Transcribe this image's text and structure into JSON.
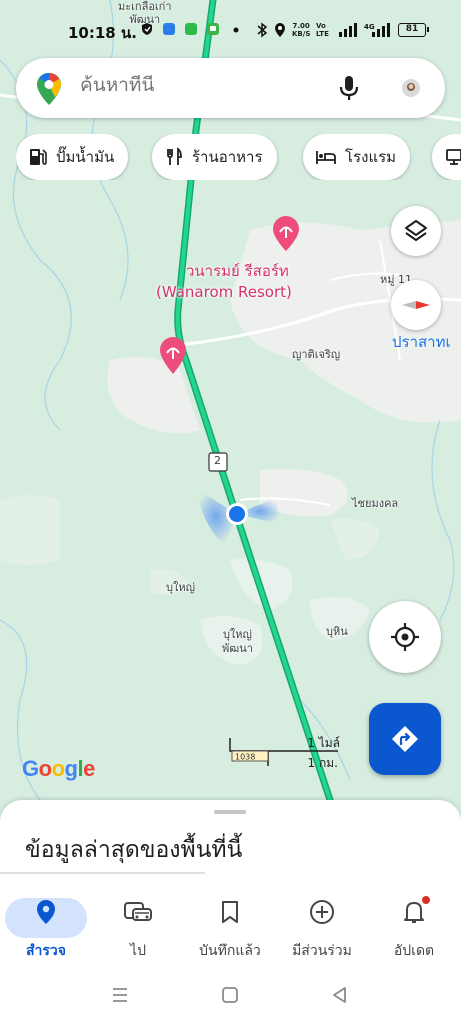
{
  "status_bar": {
    "time": "10:18 น.",
    "net_speed": "7.00\nKB/S",
    "volte": "Vo\nLTE",
    "battery": "81"
  },
  "search": {
    "placeholder": "ค้นหาที่นี่"
  },
  "chips": [
    {
      "label": "ปั๊มน้ำมัน",
      "icon": "gas-station-icon"
    },
    {
      "label": "ร้านอาหาร",
      "icon": "restaurant-icon"
    },
    {
      "label": "โรงแรม",
      "icon": "hotel-icon"
    }
  ],
  "map": {
    "labels": {
      "top_town": "มะเกลือเก่า\nพัฒนา",
      "resort_thai": "วนารมย์ รีสอร์ท",
      "resort_en": "(Wanarom Resort)",
      "moo11": "หมู่ 11",
      "prasat": "ปราสาทเ",
      "yatijaroen": "ญาติเจริญ",
      "road_shield": "2",
      "chaimongkol": "ไชยมงคล",
      "buyai": "บุใหญ่",
      "buyai_pattana": "บุใหญ่\nพัฒนา",
      "buhin": "บุหิน",
      "route_shield": "1038"
    },
    "scale": {
      "miles": "1 ไมล์",
      "km": "1 กม."
    },
    "google": "Google"
  },
  "bottom_sheet": {
    "title": "ข้อมูลล่าสุดของพื้นที่นี้"
  },
  "nav": {
    "items": [
      {
        "label": "สำรวจ",
        "icon": "explore-pin-icon",
        "active": true
      },
      {
        "label": "ไป",
        "icon": "go-car-icon",
        "active": false
      },
      {
        "label": "บันทึกแล้ว",
        "icon": "bookmark-icon",
        "active": false
      },
      {
        "label": "มีส่วนร่วม",
        "icon": "contribute-plus-icon",
        "active": false
      },
      {
        "label": "อัปเดต",
        "icon": "bell-icon",
        "active": false
      }
    ]
  },
  "colors": {
    "route": "#1ec985",
    "accent": "#0b57d0",
    "poi": "#ec4d7a",
    "map_bg": "#dbeee0"
  }
}
